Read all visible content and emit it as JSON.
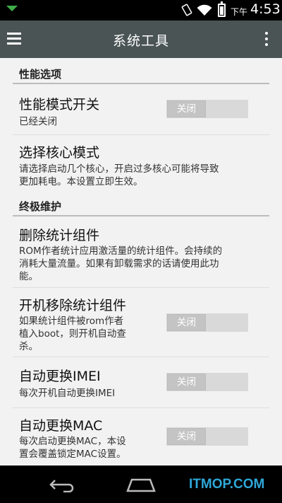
{
  "status_bar": {
    "ampm": "下午",
    "time": "4:53"
  },
  "app_bar": {
    "title": "系统工具"
  },
  "sections": [
    {
      "header": "性能选项",
      "rows": [
        {
          "title": "性能模式开关",
          "desc": "已经关闭",
          "toggle": "关闭"
        },
        {
          "title": "选择核心模式",
          "desc": "请选择启动几个核心，开启过多核心可能将导致\n更加耗电。本设置立即生效。"
        }
      ]
    },
    {
      "header": "终极维护",
      "rows": [
        {
          "title": "删除统计组件",
          "desc": "ROM作者统计应用激活量的统计组件。会持续的\n消耗大量流量。如果有卸载需求的话请使用此功\n能。"
        },
        {
          "title": "开机移除统计组件",
          "desc": "如果统计组件被rom作者\n植入boot，则开机自动查\n杀。",
          "toggle": "关闭"
        },
        {
          "title": "自动更换IMEI",
          "desc": "每次开机自动更换IMEI",
          "toggle": "关闭"
        },
        {
          "title": "自动更换MAC",
          "desc": "每次启动更换MAC，本设\n置会覆盖锁定MAC设置。",
          "toggle": "关闭"
        }
      ]
    }
  ],
  "nav": {
    "watermark": "ITMOP.COM"
  },
  "colors": {
    "app_bar": "#4b5454",
    "background": "#f2f2f2",
    "watermark": "#2ea8d8"
  }
}
